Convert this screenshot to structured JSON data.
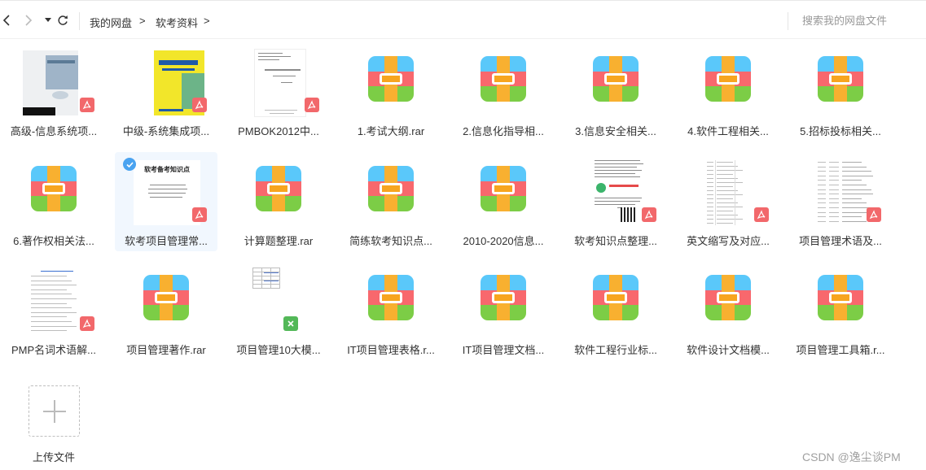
{
  "toolbar": {
    "back_icon": "chevron-left-icon",
    "forward_icon": "chevron-right-icon",
    "dropdown_icon": "caret-down-icon",
    "refresh_icon": "refresh-icon",
    "breadcrumb": [
      {
        "label": "我的网盘"
      },
      {
        "label": "软考资料"
      }
    ],
    "breadcrumb_separator": ">",
    "search_placeholder": "搜索我的网盘文件"
  },
  "files": [
    {
      "label": "高级-信息系统项...",
      "type": "pdf",
      "thumb": "book-grey"
    },
    {
      "label": "中级-系统集成项...",
      "type": "pdf",
      "thumb": "book-yellow"
    },
    {
      "label": "PMBOK2012中...",
      "type": "pdf",
      "thumb": "doc-cover"
    },
    {
      "label": "1.考试大纲.rar",
      "type": "rar"
    },
    {
      "label": "2.信息化指导相...",
      "type": "rar"
    },
    {
      "label": "3.信息安全相关...",
      "type": "rar"
    },
    {
      "label": "4.软件工程相关...",
      "type": "rar"
    },
    {
      "label": "5.招标投标相关...",
      "type": "rar"
    },
    {
      "label": "6.著作权相关法...",
      "type": "rar"
    },
    {
      "label": "软考项目管理常...",
      "type": "pdf",
      "thumb": "doc-title",
      "selected": true,
      "doc_title": "软考备考知识点"
    },
    {
      "label": "计算题整理.rar",
      "type": "rar"
    },
    {
      "label": "简练软考知识点...",
      "type": "rar"
    },
    {
      "label": "2010-2020信息...",
      "type": "rar"
    },
    {
      "label": "软考知识点整理...",
      "type": "pdf",
      "thumb": "doc-qr"
    },
    {
      "label": "英文缩写及对应...",
      "type": "pdf",
      "thumb": "doc-table"
    },
    {
      "label": "项目管理术语及...",
      "type": "pdf",
      "thumb": "doc-table2"
    },
    {
      "label": "PMP名词术语解...",
      "type": "pdf",
      "thumb": "doc-text"
    },
    {
      "label": "项目管理著作.rar",
      "type": "rar"
    },
    {
      "label": "项目管理10大模...",
      "type": "xls",
      "thumb": "sheet"
    },
    {
      "label": "IT项目管理表格.r...",
      "type": "rar"
    },
    {
      "label": "IT项目管理文档...",
      "type": "rar"
    },
    {
      "label": "软件工程行业标...",
      "type": "rar"
    },
    {
      "label": "软件设计文档模...",
      "type": "rar"
    },
    {
      "label": "项目管理工具箱.r...",
      "type": "rar"
    }
  ],
  "upload": {
    "label": "上传文件",
    "icon": "plus-icon"
  },
  "watermark": "CSDN @逸尘谈PM",
  "colors": {
    "rar_blue": "#5ac8fa",
    "rar_red": "#f8686d",
    "rar_green": "#7ccd46",
    "rar_strap": "#f8b030",
    "pdf_badge": "#f2686b",
    "xls_badge": "#53b858",
    "selected_bg": "#f1f7fe",
    "check_blue": "#4aa3f0"
  }
}
